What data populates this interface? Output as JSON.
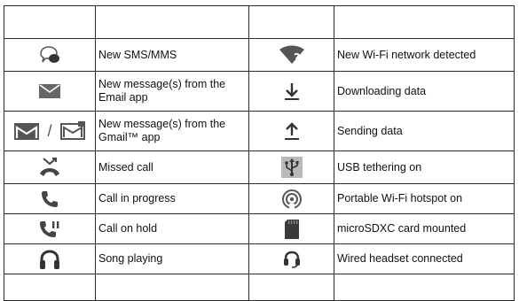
{
  "status_icons": {
    "rows": [
      {
        "left": {
          "icon": "sms-bubble-icon",
          "label": "New SMS/MMS"
        },
        "right": {
          "icon": "wifi-question-icon",
          "label": "New Wi-Fi network detected"
        }
      },
      {
        "left": {
          "icon": "envelope-icon",
          "label": "New message(s) from the Email app"
        },
        "right": {
          "icon": "download-arrow-icon",
          "label": "Downloading data"
        }
      },
      {
        "left": {
          "icon": "gmail-icon",
          "label": "New message(s) from the Gmail™ app",
          "separator": "/"
        },
        "right": {
          "icon": "upload-arrow-icon",
          "label": "Sending data"
        }
      },
      {
        "left": {
          "icon": "missed-call-icon",
          "label": "Missed call"
        },
        "right": {
          "icon": "usb-icon",
          "label": "USB tethering on"
        }
      },
      {
        "left": {
          "icon": "phone-icon",
          "label": "Call in progress"
        },
        "right": {
          "icon": "hotspot-icon",
          "label": "Portable Wi-Fi hotspot on"
        }
      },
      {
        "left": {
          "icon": "call-hold-icon",
          "label": "Call on hold"
        },
        "right": {
          "icon": "sd-card-icon",
          "label": "microSDXC card mounted"
        }
      },
      {
        "left": {
          "icon": "headphones-icon",
          "label": "Song playing"
        },
        "right": {
          "icon": "headset-icon",
          "label": "Wired headset connected"
        }
      }
    ]
  }
}
